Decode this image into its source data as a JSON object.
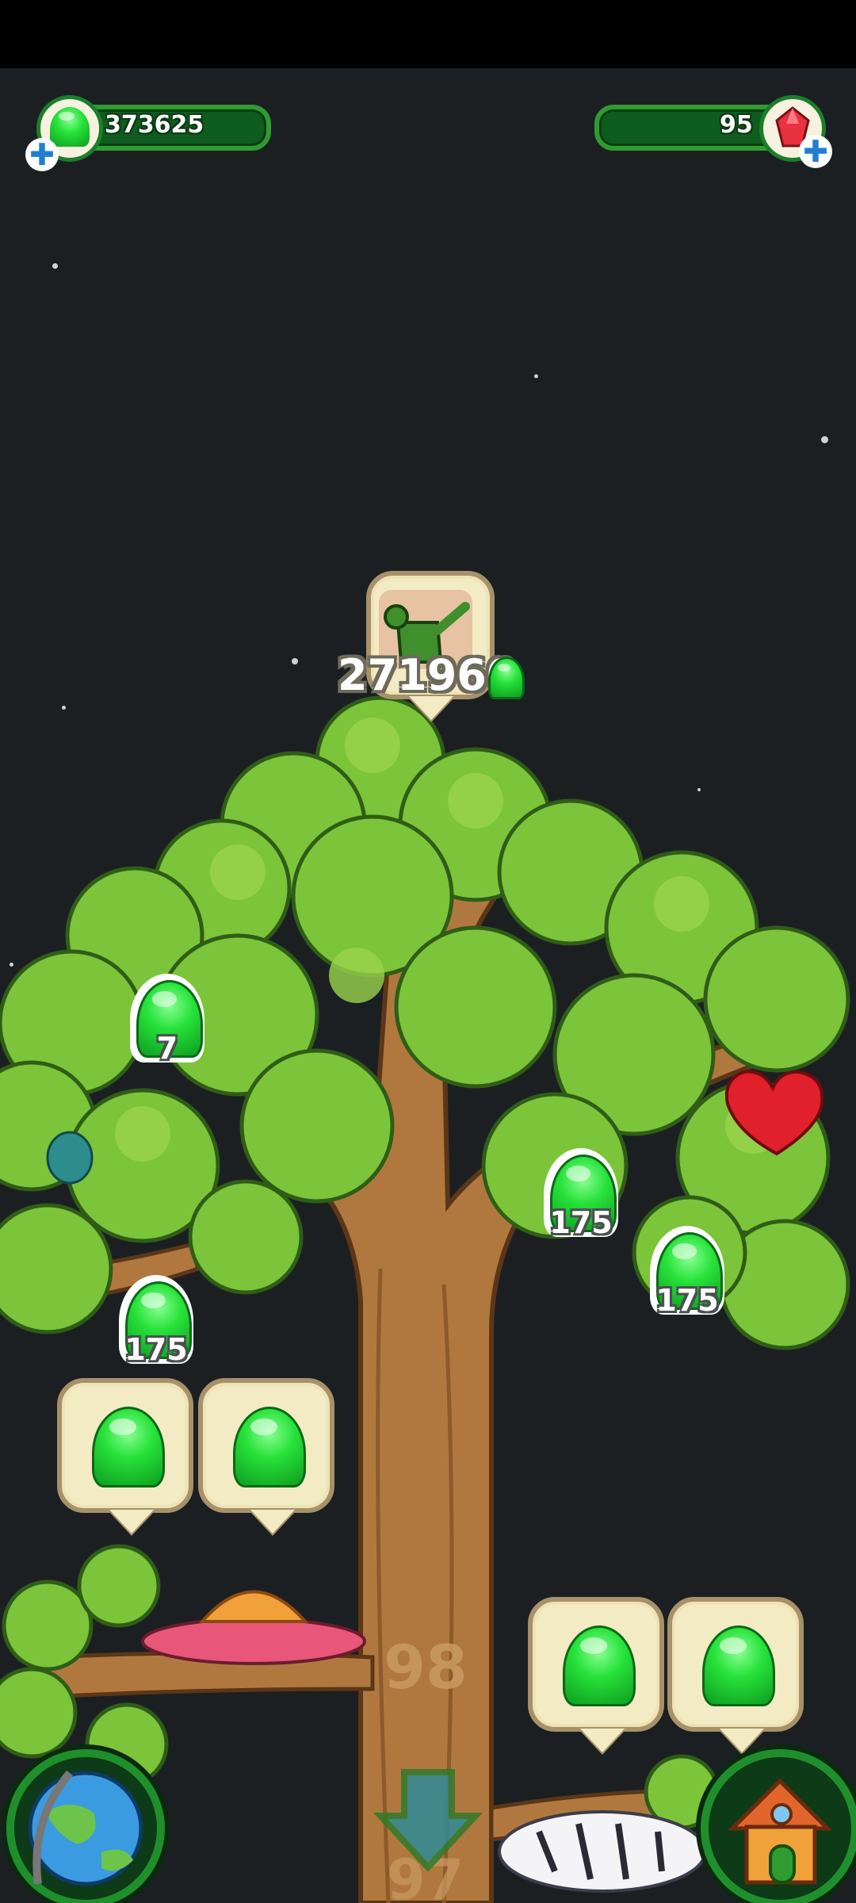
{
  "hud": {
    "jelly_count": "373625",
    "gem_count": "95",
    "icons": {
      "jelly": "green-jelly-icon",
      "gem": "red-gem-icon",
      "plus": "plus-icon"
    }
  },
  "tree": {
    "upgrade_cost": "271960",
    "upgrade_icon": "watering-can-icon",
    "level_current": "98",
    "level_next": "97",
    "jelly_badges": [
      "7",
      "175",
      "175",
      "175"
    ]
  },
  "bottom": {
    "left_icon": "globe-icon",
    "center_icon": "down-arrow-icon",
    "right_icon": "house-icon"
  },
  "colors": {
    "background": "#1b1f22",
    "leaf": "#7cc43a",
    "trunk": "#b0783f",
    "hud_green": "#2f9b31"
  }
}
